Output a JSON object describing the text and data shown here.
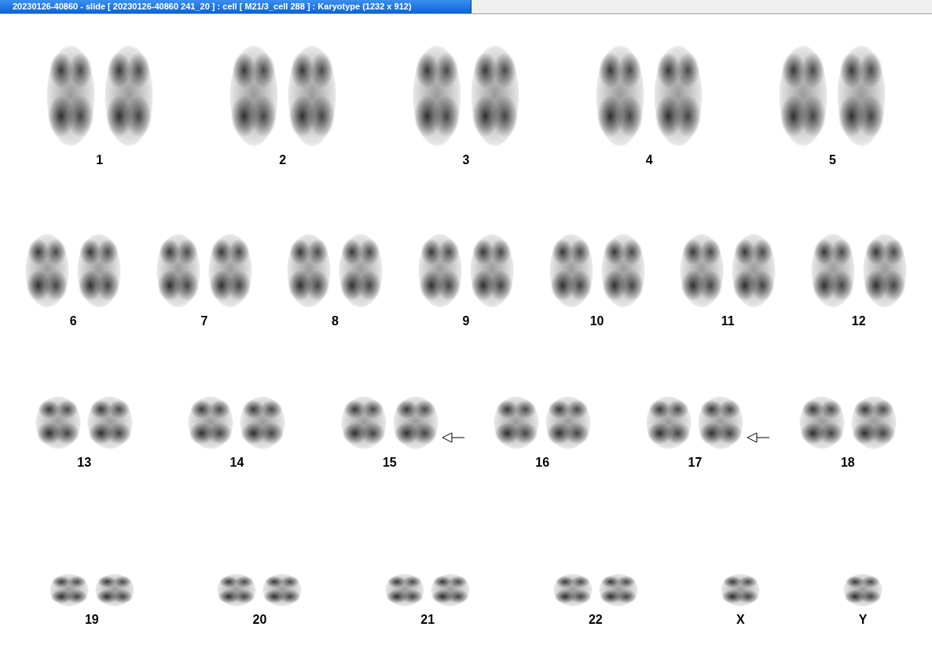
{
  "window": {
    "title": "20230126-40860 - slide [ 20230126-40860 241_20 ] : cell [ M21/3_cell 288 ] : Karyotype  (1232 x 912)"
  },
  "rows": [
    {
      "groups": [
        {
          "label": "1",
          "kind": "pair",
          "arrow": false
        },
        {
          "label": "2",
          "kind": "pair",
          "arrow": false
        },
        {
          "label": "3",
          "kind": "pair",
          "arrow": false
        },
        {
          "label": "4",
          "kind": "pair",
          "arrow": false
        },
        {
          "label": "5",
          "kind": "pair",
          "arrow": false
        }
      ]
    },
    {
      "groups": [
        {
          "label": "6",
          "kind": "pair",
          "arrow": false
        },
        {
          "label": "7",
          "kind": "pair",
          "arrow": false
        },
        {
          "label": "8",
          "kind": "pair",
          "arrow": false
        },
        {
          "label": "9",
          "kind": "pair",
          "arrow": false
        },
        {
          "label": "10",
          "kind": "pair",
          "arrow": false
        },
        {
          "label": "11",
          "kind": "pair",
          "arrow": false
        },
        {
          "label": "12",
          "kind": "pair",
          "arrow": false
        }
      ]
    },
    {
      "groups": [
        {
          "label": "13",
          "kind": "pair",
          "arrow": false
        },
        {
          "label": "14",
          "kind": "pair",
          "arrow": false
        },
        {
          "label": "15",
          "kind": "pair",
          "arrow": true
        },
        {
          "label": "16",
          "kind": "pair",
          "arrow": false
        },
        {
          "label": "17",
          "kind": "pair",
          "arrow": true
        },
        {
          "label": "18",
          "kind": "pair",
          "arrow": false
        }
      ]
    },
    {
      "groups": [
        {
          "label": "19",
          "kind": "pair",
          "arrow": false
        },
        {
          "label": "20",
          "kind": "pair",
          "arrow": false
        },
        {
          "label": "21",
          "kind": "pair",
          "arrow": false
        },
        {
          "label": "22",
          "kind": "pair",
          "arrow": false
        },
        {
          "label": "X",
          "kind": "single",
          "arrow": false
        },
        {
          "label": "Y",
          "kind": "single",
          "arrow": false
        }
      ]
    }
  ]
}
